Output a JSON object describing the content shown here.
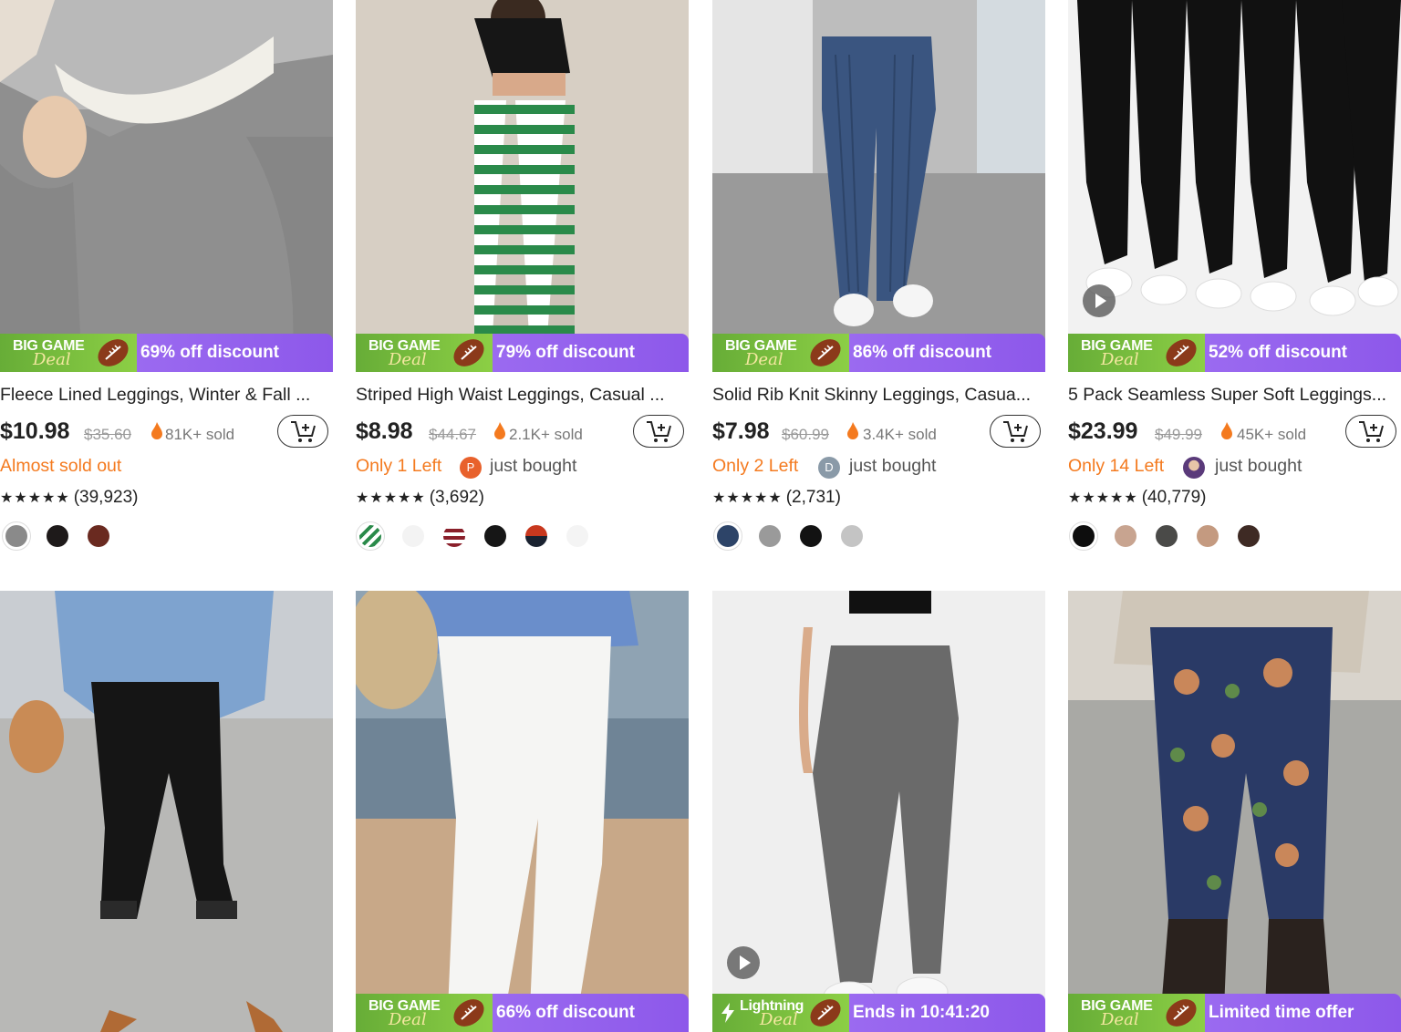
{
  "colors": {
    "accent_orange": "#f47a1f",
    "banner_purple": "#9b6af0",
    "banner_green": "#74b93c"
  },
  "products": [
    {
      "title": "Fleece Lined Leggings, Winter & Fall ...",
      "badge_1": "BIG GAME",
      "badge_2": "Deal",
      "promo": "69% off discount",
      "price": "$10.98",
      "old_price": "$35.60",
      "sold": "81K+ sold",
      "status": "Almost sold out",
      "rating_stars": "★★★★★",
      "rating_count": "(39,923)"
    },
    {
      "title": "Striped High Waist Leggings, Casual ...",
      "badge_1": "BIG GAME",
      "badge_2": "Deal",
      "promo": "79% off discount",
      "price": "$8.98",
      "old_price": "$44.67",
      "sold": "2.1K+ sold",
      "status": "Only 1 Left",
      "buyer_initial": "P",
      "bought": "just bought",
      "rating_stars": "★★★★★",
      "rating_count": "(3,692)"
    },
    {
      "title": "Solid Rib Knit Skinny Leggings, Casua...",
      "badge_1": "BIG GAME",
      "badge_2": "Deal",
      "promo": "86% off discount",
      "price": "$7.98",
      "old_price": "$60.99",
      "sold": "3.4K+ sold",
      "status": "Only 2 Left",
      "buyer_initial": "D",
      "bought": "just bought",
      "rating_stars": "★★★★★",
      "rating_count": "(2,731)"
    },
    {
      "title": "5 Pack Seamless Super Soft Leggings...",
      "badge_1": "BIG GAME",
      "badge_2": "Deal",
      "promo": "52% off discount",
      "price": "$23.99",
      "old_price": "$49.99",
      "sold": "45K+ sold",
      "status": "Only 14 Left",
      "bought": "just bought",
      "rating_stars": "★★★★★",
      "rating_count": "(40,779)"
    },
    {
      "badge_1": "",
      "badge_2": "",
      "promo": ""
    },
    {
      "badge_1": "BIG GAME",
      "badge_2": "Deal",
      "promo": "66% off discount"
    },
    {
      "badge_1": "Lightning",
      "badge_2": "Deal",
      "promo": "Ends in 10:41:20"
    },
    {
      "badge_1": "BIG GAME",
      "badge_2": "Deal",
      "promo": "Limited time offer"
    }
  ]
}
